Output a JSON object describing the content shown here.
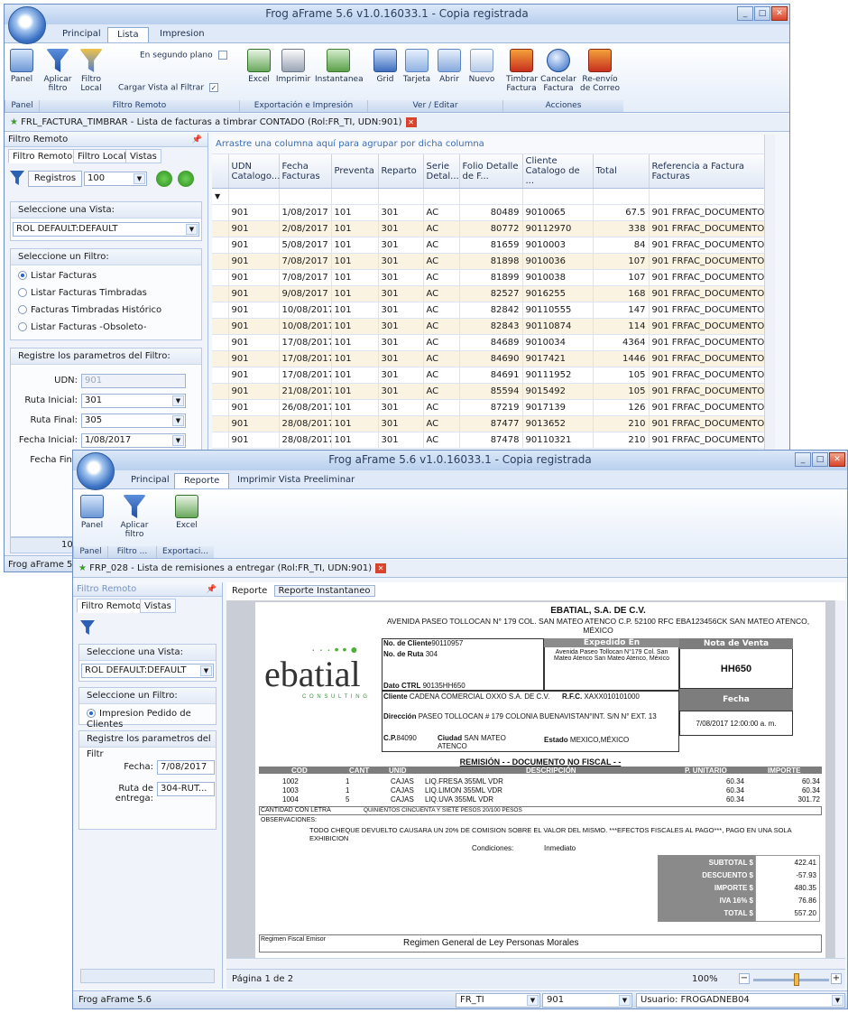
{
  "back": {
    "title": "Frog aFrame 5.6 v1.0.16033.1 - Copia registrada",
    "tabs": [
      "Principal",
      "Lista",
      "Impresion"
    ],
    "active_tab": "Lista",
    "ribbon": {
      "panel": "Panel",
      "aplicar": "Aplicar filtro",
      "filtro_local": "Filtro Local",
      "en_segundo_plano": "En segundo plano",
      "cargar_vista": "Cargar Vista al Filtrar",
      "excel": "Excel",
      "imprimir": "Imprimir",
      "instantanea": "Instantanea",
      "grid": "Grid",
      "tarjeta": "Tarjeta",
      "abrir": "Abrir",
      "nuevo": "Nuevo",
      "timbrar": "Timbrar Factura",
      "cancelar": "Cancelar Factura",
      "reenvio": "Re-envío de Correo",
      "groups": [
        "Panel",
        "Filtro Remoto",
        "Exportación e Impresión",
        "Ver / Editar",
        "Acciones"
      ]
    },
    "doc_tab": "FRL_FACTURA_TIMBRAR - Lista de facturas a timbrar CONTADO (Rol:FR_TI, UDN:901)",
    "panel_title": "Filtro Remoto",
    "panel_tabs": [
      "Filtro Remoto",
      "Filtro Local",
      "Vistas"
    ],
    "registros_label": "Registros",
    "registros_value": "100",
    "vista_header": "Seleccione una Vista:",
    "vista_value": "ROL DEFAULT:DEFAULT",
    "filtro_header": "Seleccione un Filtro:",
    "filtros": [
      "Listar Facturas",
      "Listar Facturas Timbradas",
      "Facturas Timbradas Histórico",
      "Listar Facturas -Obsoleto-"
    ],
    "params_header": "Registre los parametros del Filtro:",
    "udn_label": "UDN:",
    "udn_value": "901",
    "ruta_ini_label": "Ruta Inicial:",
    "ruta_ini_value": "301",
    "ruta_fin_label": "Ruta Final:",
    "ruta_fin_value": "305",
    "fecha_ini_label": "Fecha Inicial:",
    "fecha_ini_value": "1/08/2017",
    "fecha_fin_label": "Fecha Fina",
    "group_hint": "Arrastre una columna aquí para agrupar por dicha columna",
    "columns": [
      "UDN Catalogo...",
      "Fecha Facturas",
      "Preventa",
      "Reparto",
      "Serie Detal...",
      "Folio Detalle de F...",
      "Cliente Catalogo de ...",
      "Total",
      "Referencia a Factura Facturas"
    ],
    "rows": [
      [
        "901",
        "1/08/2017",
        "101",
        "301",
        "AC",
        "80489",
        "9010065",
        "67.5",
        "901 FRFAC_DOCUMENTO/AC-8"
      ],
      [
        "901",
        "2/08/2017",
        "101",
        "301",
        "AC",
        "80772",
        "90112970",
        "338",
        "901 FRFAC_DOCUMENTO/AC-8"
      ],
      [
        "901",
        "5/08/2017",
        "101",
        "301",
        "AC",
        "81659",
        "9010003",
        "84",
        "901 FRFAC_DOCUMENTO/AC-8"
      ],
      [
        "901",
        "7/08/2017",
        "101",
        "301",
        "AC",
        "81898",
        "9010036",
        "107",
        "901 FRFAC_DOCUMENTO/AC-8"
      ],
      [
        "901",
        "7/08/2017",
        "101",
        "301",
        "AC",
        "81899",
        "9010038",
        "107",
        "901 FRFAC_DOCUMENTO/AC-8"
      ],
      [
        "901",
        "9/08/2017",
        "101",
        "301",
        "AC",
        "82527",
        "9016255",
        "168",
        "901 FRFAC_DOCUMENTO/AC-8"
      ],
      [
        "901",
        "10/08/2017",
        "101",
        "301",
        "AC",
        "82842",
        "90110555",
        "147",
        "901 FRFAC_DOCUMENTO/AC-8"
      ],
      [
        "901",
        "10/08/2017",
        "101",
        "301",
        "AC",
        "82843",
        "90110874",
        "114",
        "901 FRFAC_DOCUMENTO/AC-8"
      ],
      [
        "901",
        "17/08/2017",
        "101",
        "301",
        "AC",
        "84689",
        "9010034",
        "4364",
        "901 FRFAC_DOCUMENTO/AC-8"
      ],
      [
        "901",
        "17/08/2017",
        "101",
        "301",
        "AC",
        "84690",
        "9017421",
        "1446",
        "901 FRFAC_DOCUMENTO/AC-8"
      ],
      [
        "901",
        "17/08/2017",
        "101",
        "301",
        "AC",
        "84691",
        "90111952",
        "105",
        "901 FRFAC_DOCUMENTO/AC-8"
      ],
      [
        "901",
        "21/08/2017",
        "101",
        "301",
        "AC",
        "85594",
        "9015492",
        "105",
        "901 FRFAC_DOCUMENTO/AC-8"
      ],
      [
        "901",
        "26/08/2017",
        "101",
        "301",
        "AC",
        "87219",
        "9017139",
        "126",
        "901 FRFAC_DOCUMENTO/AC-8"
      ],
      [
        "901",
        "28/08/2017",
        "101",
        "301",
        "AC",
        "87477",
        "9013652",
        "210",
        "901 FRFAC_DOCUMENTO/AC-8"
      ],
      [
        "901",
        "28/08/2017",
        "101",
        "301",
        "AC",
        "87478",
        "90110321",
        "210",
        "901 FRFAC_DOCUMENTO/AC-8"
      ]
    ],
    "status_app": "Frog aFrame 5.",
    "panel_bottom_count": "100"
  },
  "front": {
    "title": "Frog aFrame 5.6 v1.0.16033.1 - Copia registrada",
    "tabs": [
      "Principal",
      "Reporte",
      "Imprimir Vista Preeliminar"
    ],
    "active_tab": "Reporte",
    "ribbon": {
      "panel": "Panel",
      "aplicar": "Aplicar filtro",
      "excel": "Excel",
      "groups": [
        "Panel",
        "Filtro ...",
        "Exportaci..."
      ]
    },
    "doc_tab": "FRP_028 - Lista de remisiones a entregar (Rol:FR_TI, UDN:901)",
    "panel_title": "Filtro Remoto",
    "panel_tabs": [
      "Filtro Remoto",
      "Vistas"
    ],
    "vista_header": "Seleccione una Vista:",
    "vista_value": "ROL DEFAULT:DEFAULT",
    "filtro_header": "Seleccione un Filtro:",
    "filtro_value": "Impresion Pedido de Clientes",
    "params_header": "Registre los parametros del Filtr",
    "fecha_label": "Fecha:",
    "fecha_value": "7/08/2017",
    "ruta_label": "Ruta de entrega:",
    "ruta_value": "304-RUT...",
    "report_tabs": [
      "Reporte",
      "Reporte Instantaneo"
    ],
    "page_label": "Página 1 de 2",
    "zoom": "100%",
    "status_app": "Frog aFrame 5.6",
    "status_rol": "FR_TI",
    "status_udn": "901",
    "status_user": "Usuario: FROGADNEB04",
    "report": {
      "company": "EBATIAL, S.A. DE C.V.",
      "address": "AVENIDA PASEO TOLLOCAN N° 179 COL. SAN MATEO ATENCO C.P. 52100 RFC EBA123456CK SAN MATEO ATENCO, MÉXICO",
      "logo_text": "ebatial",
      "logo_sub": "C O N S U L T I N G",
      "no_cliente_label": "No. de Cliente",
      "no_cliente": "90110957",
      "no_ruta_label": "No. de Ruta",
      "no_ruta": "304",
      "dato_ctrl_label": "Dato CTRL",
      "dato_ctrl": "90135HH650",
      "cliente_label": "Cliente",
      "cliente": "CADENA COMERCIAL OXXO S.A. DE C.V.",
      "rfc_label": "R.F.C.",
      "rfc": "XAXX010101000",
      "direccion_label": "Dirección",
      "direccion": "PASEO TOLLOCAN # 179 COLONIA BUENAVISTAN°INT. S/N N° EXT. 13",
      "cp_label": "C.P.",
      "cp": "84090",
      "ciudad_label": "Ciudad",
      "ciudad": "SAN MATEO ATENCO",
      "estado_label": "Estado",
      "estado": "MEXICO,MÉXICO",
      "expedido_label": "Expedido En",
      "expedido": "Avenida Paseo Tollocan N°179 Col. San Mateo Atenco San Mateo Atenco, México",
      "nota_label": "Nota de Venta",
      "nota": "HH650",
      "fecha_label": "Fecha",
      "fecha": "7/08/2017 12:00:00 a. m.",
      "remision": "REMISIÓN - - DOCUMENTO NO FISCAL - -",
      "cols": [
        "COD",
        "CANT",
        "UNID",
        "DESCRIPCIÓN",
        "P. UNITARIO",
        "IMPORTE"
      ],
      "items": [
        [
          "1002",
          "1",
          "CAJAS",
          "LIQ.FRESA 355ML VDR",
          "60.34",
          "60.34"
        ],
        [
          "1003",
          "1",
          "CAJAS",
          "LIQ.LIMON 355ML VDR",
          "60.34",
          "60.34"
        ],
        [
          "1004",
          "5",
          "CAJAS",
          "LIQ.UVA 355ML VDR",
          "60.34",
          "301.72"
        ]
      ],
      "cantidad_letra_label": "CANTIDAD CON LETRA",
      "cantidad_letra": "QUINIENTOS CINCUENTA Y SIETE PESOS 20/100 PESOS",
      "observaciones_label": "OBSERVACIONES:",
      "observaciones": "TODO CHEQUE DEVUELTO CAUSARA UN 20% DE COMISION SOBRE EL VALOR DEL MISMO. ***EFECTOS FISCALES AL PAGO***, PAGO EN UNA SOLA EXHIBICION",
      "condiciones_label": "Condiciones:",
      "condiciones": "Inmediato",
      "totals": [
        [
          "SUBTOTAL $",
          "422.41"
        ],
        [
          "DESCUENTO $",
          "-57.93"
        ],
        [
          "IMPORTE $",
          "480.35"
        ],
        [
          "IVA 16% $",
          "76.86"
        ],
        [
          "TOTAL $",
          "557.20"
        ]
      ],
      "regimen_label": "Regimen Fiscal Emisor",
      "regimen": "Regimen General de Ley Personas Morales"
    }
  }
}
